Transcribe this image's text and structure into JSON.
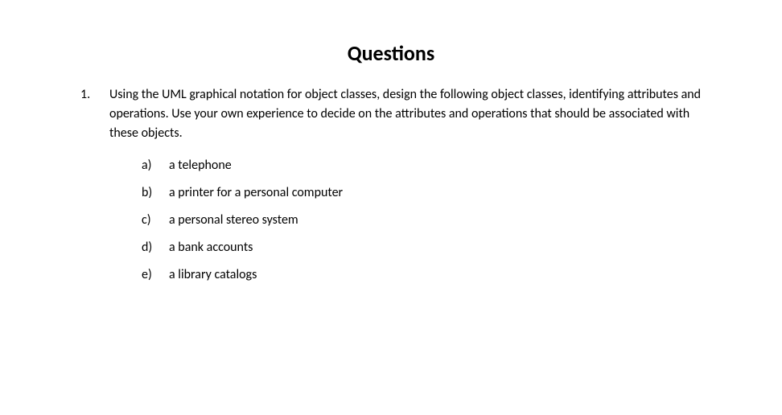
{
  "title": "Questions",
  "question": {
    "number": "1.",
    "prompt": "Using the UML graphical notation for object classes, design the following object classes, identifying attributes and operations. Use your own experience to decide on the attributes and operations that should be associated with these objects.",
    "subs": [
      {
        "letter": "a)",
        "text": "a telephone"
      },
      {
        "letter": "b)",
        "text": "a printer for a personal computer"
      },
      {
        "letter": "c)",
        "text": "a personal stereo system"
      },
      {
        "letter": "d)",
        "text": "a bank accounts"
      },
      {
        "letter": "e)",
        "text": "a library catalogs"
      }
    ]
  }
}
